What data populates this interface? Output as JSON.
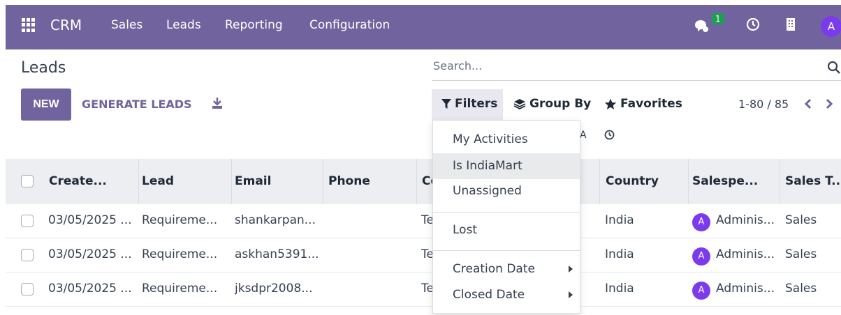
{
  "topbar": {
    "app_name": "CRM",
    "menu": [
      "Sales",
      "Leads",
      "Reporting",
      "Configuration"
    ],
    "chat_badge": "1",
    "avatar_letter": "A",
    "color": "#71639e"
  },
  "page": {
    "title": "Leads",
    "new_label": "NEW",
    "generate_label": "GENERATE LEADS"
  },
  "search": {
    "placeholder": "Search..."
  },
  "toolbar": {
    "filters_label": "Filters",
    "groupby_label": "Group By",
    "favorites_label": "Favorites",
    "pager_text": "1-80 / 85"
  },
  "filters_dropdown": {
    "items": [
      "My Activities",
      "Is IndiaMart",
      "Unassigned",
      "Lost",
      "Creation Date",
      "Closed Date"
    ],
    "active_item": "Is IndiaMart"
  },
  "table": {
    "columns": [
      "Create...",
      "Lead",
      "Email",
      "Phone",
      "Co",
      "Country",
      "Salespe...",
      "Sales T..."
    ],
    "rows": [
      {
        "created": "03/05/2025 ...",
        "lead": "Requireme...",
        "email": "shankarpan...",
        "phone": "",
        "company": "Te",
        "country": "India",
        "salesperson": "Adminis...",
        "avatar": "A",
        "sales_team": "Sales"
      },
      {
        "created": "03/05/2025 ...",
        "lead": "Requireme...",
        "email": "askhan5391...",
        "phone": "",
        "company": "Te",
        "country": "India",
        "salesperson": "Adminis...",
        "avatar": "A",
        "sales_team": "Sales"
      },
      {
        "created": "03/05/2025 ...",
        "lead": "Requireme...",
        "email": "jksdpr2008...",
        "phone": "",
        "company": "Te",
        "country": "India",
        "salesperson": "Adminis...",
        "avatar": "A",
        "sales_team": "Sales"
      }
    ]
  },
  "hint_letter": "A"
}
